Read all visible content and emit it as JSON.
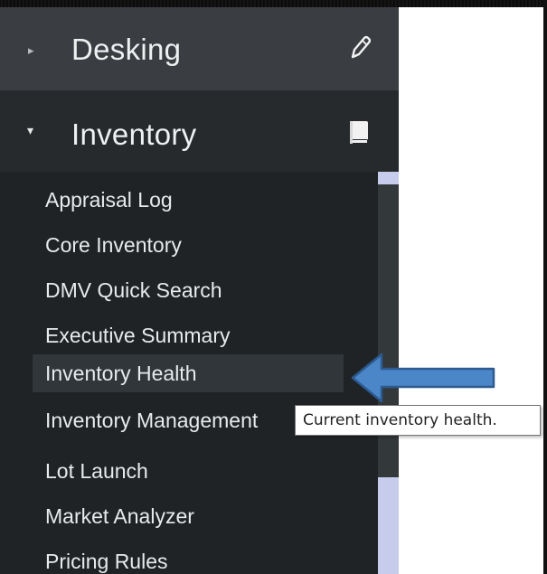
{
  "sidebar": {
    "sections": [
      {
        "title": "Desking",
        "icon": "pencil-icon",
        "arrow": "▸",
        "expanded": false
      },
      {
        "title": "Inventory",
        "icon": "book-icon",
        "arrow": "▾",
        "expanded": true
      }
    ],
    "inventory_items": [
      {
        "label": "Appraisal Log"
      },
      {
        "label": "Core Inventory"
      },
      {
        "label": "DMV Quick Search"
      },
      {
        "label": "Executive Summary"
      },
      {
        "label": "Inventory Health",
        "selected": true
      },
      {
        "label": "Inventory Management"
      },
      {
        "label": "Lot Launch"
      },
      {
        "label": "Market Analyzer"
      },
      {
        "label": "Pricing Rules"
      }
    ]
  },
  "tooltip": {
    "text": "Current inventory health."
  },
  "colors": {
    "sidebar_bg": "#2c3033",
    "header_desking_bg": "#3a3e42",
    "list_bg": "#1f2326",
    "selected_bg": "#30363a",
    "scroll_thumb": "#c7cced",
    "arrow_fill": "#4a86c8"
  }
}
